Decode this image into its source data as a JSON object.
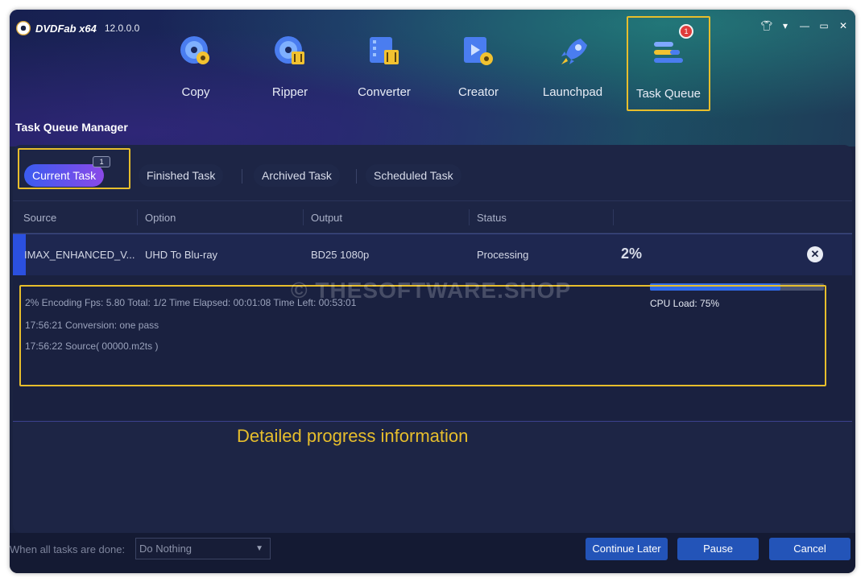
{
  "app": {
    "name": "DVDFab x64",
    "version": "12.0.0.0"
  },
  "window_controls": [
    "shirt-icon",
    "dropdown-icon",
    "minimize-icon",
    "maximize-icon",
    "close-icon"
  ],
  "nav": [
    {
      "label": "Copy",
      "icon": "copy-disc-icon"
    },
    {
      "label": "Ripper",
      "icon": "ripper-disc-icon"
    },
    {
      "label": "Converter",
      "icon": "converter-film-icon"
    },
    {
      "label": "Creator",
      "icon": "creator-icon"
    },
    {
      "label": "Launchpad",
      "icon": "rocket-icon"
    },
    {
      "label": "Task Queue",
      "icon": "task-queue-icon",
      "active": true,
      "badge": "1"
    }
  ],
  "page_title": "Task Queue Manager",
  "tabs": [
    {
      "label": "Current Task",
      "badge": "1",
      "active": true
    },
    {
      "label": "Finished Task"
    },
    {
      "label": "Archived Task"
    },
    {
      "label": "Scheduled Task"
    }
  ],
  "columns": [
    "Source",
    "Option",
    "Output",
    "Status"
  ],
  "task": {
    "source": "IMAX_ENHANCED_V...",
    "option": "UHD To Blu-ray",
    "output": "BD25 1080p",
    "status": "Processing",
    "percent": "2%"
  },
  "details": {
    "line1": "2%  Encoding Fps: 5.80   Total: 1/2   Time Elapsed: 00:01:08  Time Left: 00:53:01",
    "line2": "17:56:21  Conversion: one pass",
    "line3": "17:56:22  Source( 00000.m2ts )",
    "cpu_label": "CPU Load: 75%",
    "cpu_load": 0.75
  },
  "watermark": "© THESOFTWARE.SHOP",
  "annotation": "Detailed progress information",
  "footer": {
    "when_done_label": "When all tasks are done:",
    "when_done_value": "Do Nothing",
    "continue_later": "Continue Later",
    "pause": "Pause",
    "cancel": "Cancel"
  },
  "colors": {
    "highlight": "#e7be2c",
    "accent": "#2b50e0",
    "button": "#2354b8"
  }
}
